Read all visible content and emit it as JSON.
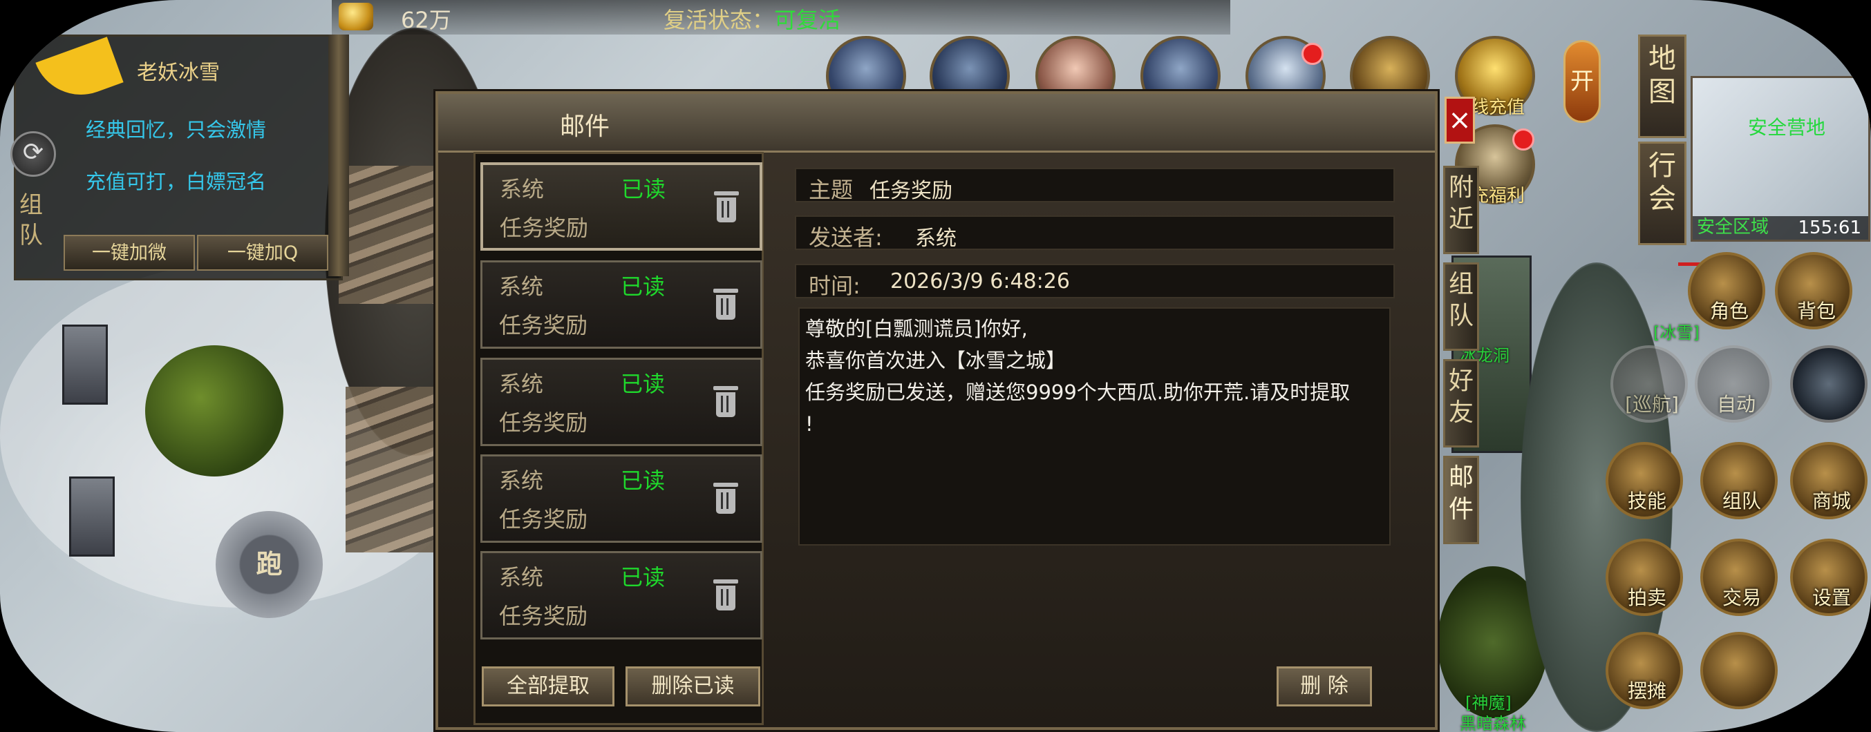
{
  "top": {
    "gold": "62万",
    "revive_label": "复活状态：",
    "revive_value": "可复活"
  },
  "player": {
    "name": "老妖冰雪",
    "mottos": [
      "经典回忆，只会激情",
      "充值可打，白嫖冠名"
    ],
    "btn_wechat": "一键加微",
    "btn_qq": "一键加Q",
    "team_tab": "组队"
  },
  "joystick": {
    "label": "跑"
  },
  "top_icons": {
    "recharge": "线充值",
    "welfare": "充福利",
    "open": "开"
  },
  "right": {
    "map_tab": "地图",
    "guild_tab": "行会",
    "minimap": {
      "safe_camp": "安全营地",
      "zone": "安全区域",
      "coords": "155:61"
    }
  },
  "action_buttons": {
    "role": "角色",
    "bag": "背包",
    "cruise": "[巡航]",
    "auto": "自动",
    "skill": "技能",
    "team": "组队",
    "shop": "商城",
    "auction": "拍卖",
    "trade": "交易",
    "settings": "设置",
    "stall": "摆摊"
  },
  "map_labels": [
    "[冰雪]",
    "冰龙洞",
    "[神魔]",
    "黑暗森林"
  ],
  "mail": {
    "title": "邮件",
    "close": "×",
    "side_tabs": [
      "附近",
      "组队",
      "好友",
      "邮件"
    ],
    "items": [
      {
        "sender": "系统",
        "status": "已读",
        "subject": "任务奖励"
      },
      {
        "sender": "系统",
        "status": "已读",
        "subject": "任务奖励"
      },
      {
        "sender": "系统",
        "status": "已读",
        "subject": "任务奖励"
      },
      {
        "sender": "系统",
        "status": "已读",
        "subject": "任务奖励"
      },
      {
        "sender": "系统",
        "status": "已读",
        "subject": "任务奖励"
      }
    ],
    "detail": {
      "subject_label": "主题",
      "subject": "任务奖励",
      "sender_label": "发送者:",
      "sender": "系统",
      "time_label": "时间:",
      "time": "2026/3/9 6:48:26",
      "body": [
        "尊敬的[白瓢测谎员]你好,",
        "恭喜你首次进入【冰雪之城】",
        "任务奖励已发送，赠送您9999个大西瓜.助你开荒.请及时提取",
        "!"
      ]
    },
    "btn_claim_all": "全部提取",
    "btn_delete_read": "删除已读",
    "btn_delete": "删 除"
  }
}
